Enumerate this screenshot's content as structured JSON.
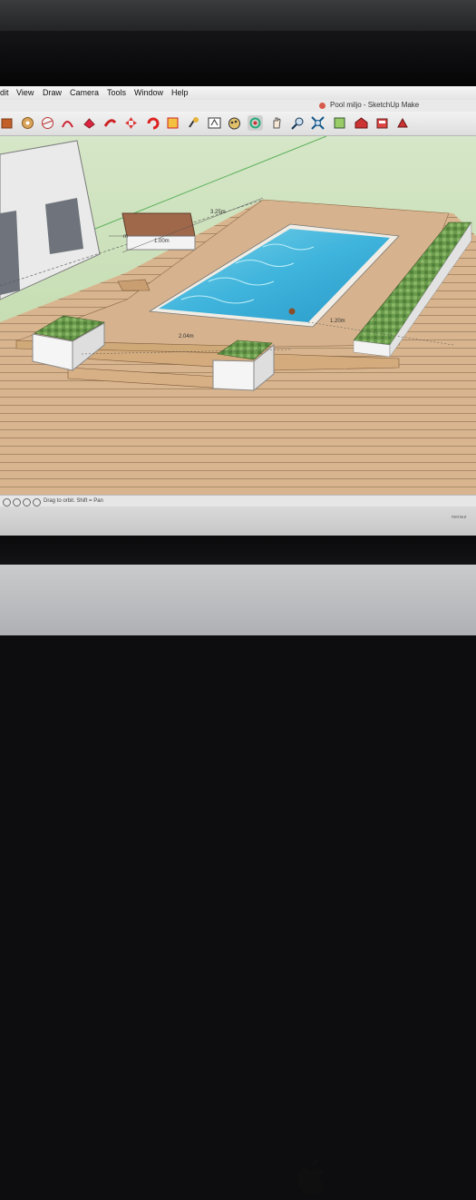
{
  "app": {
    "title": "Pool miljo - SketchUp Make"
  },
  "menu": [
    {
      "id": "edit",
      "label": "dit"
    },
    {
      "id": "view",
      "label": "View"
    },
    {
      "id": "draw",
      "label": "Draw"
    },
    {
      "id": "camera",
      "label": "Camera"
    },
    {
      "id": "tools",
      "label": "Tools"
    },
    {
      "id": "window",
      "label": "Window"
    },
    {
      "id": "help",
      "label": "Help"
    }
  ],
  "toolbar": {
    "icons": [
      "paint-bucket-icon",
      "tape-measure-icon",
      "protractor-icon",
      "arc-icon",
      "push-pull-icon",
      "follow-me-icon",
      "move-icon",
      "rotate-icon",
      "scale-icon",
      "dimension-icon",
      "text-icon",
      "paint-icon",
      "orbit-icon",
      "pan-icon",
      "zoom-icon",
      "zoom-extents-icon",
      "section-icon",
      "warehouse-icon",
      "extension-icon",
      "share-icon"
    ]
  },
  "model": {
    "dimensions": {
      "top_edge": "3.25m",
      "rail_left": "1.00m",
      "rail_small": "m",
      "bottom_edge": "2.04m",
      "right_edge": "1.20m"
    }
  },
  "status": {
    "hint": "Drag to orbit.  Shift = Pan"
  },
  "below_screen": {
    "label": "mensur"
  }
}
